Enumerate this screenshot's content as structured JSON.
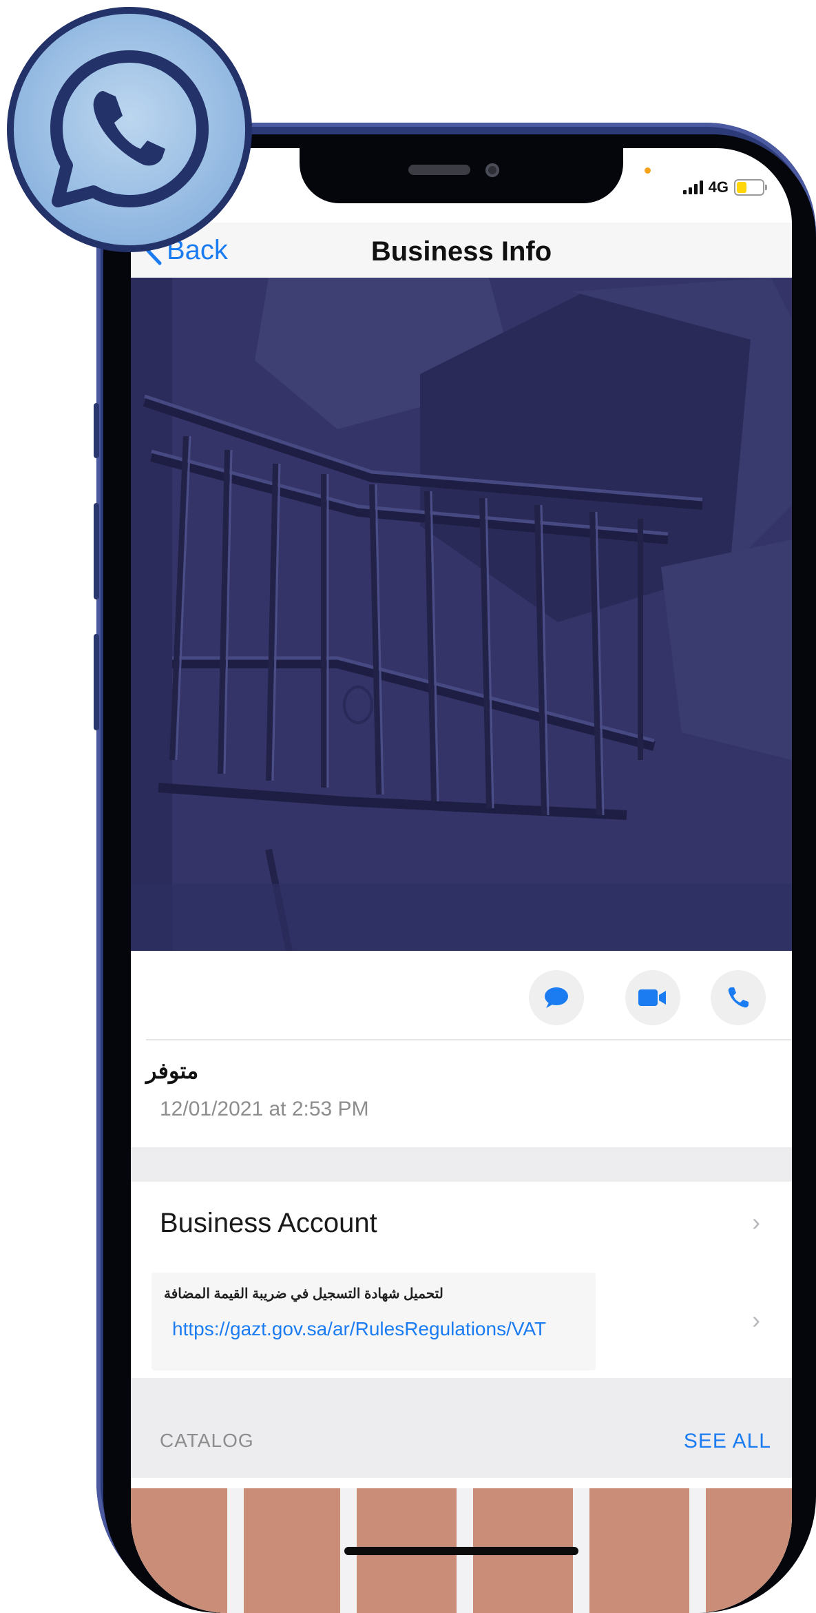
{
  "status_bar": {
    "network": "4G",
    "signal_bars": 4,
    "battery_level": 0.3
  },
  "nav": {
    "back_label": "Back",
    "title": "Business Info"
  },
  "hero": {
    "image": "shopping-cart-photo"
  },
  "actions": [
    {
      "name": "message-button",
      "icon": "message-icon"
    },
    {
      "name": "video-call-button",
      "icon": "video-icon"
    },
    {
      "name": "voice-call-button",
      "icon": "phone-icon"
    }
  ],
  "about": {
    "status": "متوفر",
    "date": "12/01/2021 at 2:53 PM"
  },
  "business_account": {
    "label": "Business Account"
  },
  "description": {
    "text_ar": "لتحميل شهادة التسجيل في ضريبة القيمة المضافة",
    "link": "https://gazt.gov.sa/ar/RulesRegulations/VAT"
  },
  "catalog": {
    "title": "CATALOG",
    "see_all": "SEE ALL"
  },
  "colors": {
    "accent": "#1b7cf2",
    "phone_frame": "#2c3a78",
    "hero_tint": "#343468",
    "whatsapp_badge": "#8fb6e0"
  }
}
